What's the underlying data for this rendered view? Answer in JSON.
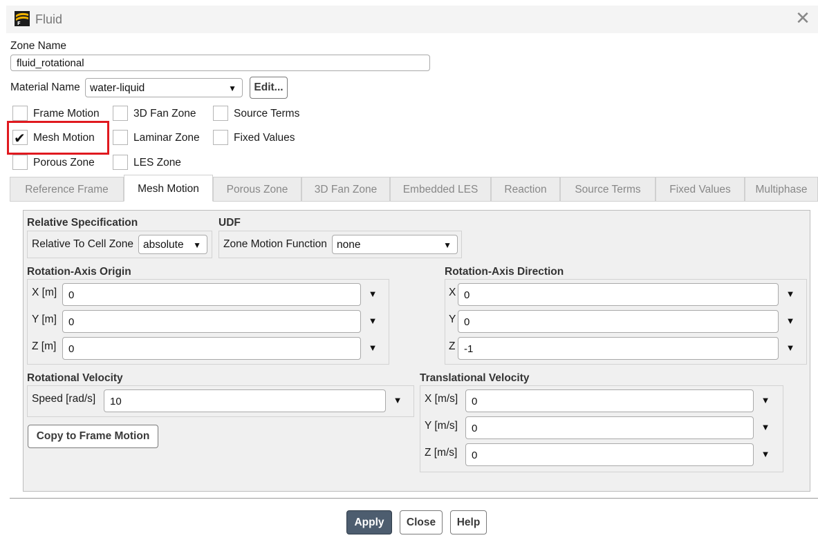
{
  "window": {
    "title": "Fluid",
    "close_glyph": "✕"
  },
  "zone": {
    "label": "Zone Name",
    "value": "fluid_rotational"
  },
  "material": {
    "label": "Material Name",
    "value": "water-liquid",
    "edit_label": "Edit..."
  },
  "options": [
    {
      "label": "Frame Motion",
      "checked": false
    },
    {
      "label": "3D Fan Zone",
      "checked": false
    },
    {
      "label": "Source Terms",
      "checked": false
    },
    {
      "label": "Mesh Motion",
      "checked": true
    },
    {
      "label": "Laminar Zone",
      "checked": false
    },
    {
      "label": "Fixed Values",
      "checked": false
    },
    {
      "label": "Porous Zone",
      "checked": false
    },
    {
      "label": "LES Zone",
      "checked": false
    }
  ],
  "tabs": [
    "Reference Frame",
    "Mesh Motion",
    "Porous Zone",
    "3D Fan Zone",
    "Embedded LES",
    "Reaction",
    "Source Terms",
    "Fixed Values",
    "Multiphase"
  ],
  "active_tab": "Mesh Motion",
  "relative_spec": {
    "title": "Relative Specification",
    "label": "Relative To Cell Zone",
    "value": "absolute"
  },
  "udf": {
    "title": "UDF",
    "label": "Zone Motion Function",
    "value": "none"
  },
  "axis_origin": {
    "title": "Rotation-Axis Origin",
    "fields": [
      {
        "label": "X [m]",
        "value": "0"
      },
      {
        "label": "Y [m]",
        "value": "0"
      },
      {
        "label": "Z [m]",
        "value": "0"
      }
    ]
  },
  "axis_direction": {
    "title": "Rotation-Axis Direction",
    "fields": [
      {
        "label": "X",
        "value": "0"
      },
      {
        "label": "Y",
        "value": "0"
      },
      {
        "label": "Z",
        "value": "-1"
      }
    ]
  },
  "rotational_velocity": {
    "title": "Rotational Velocity",
    "label": "Speed [rad/s]",
    "value": "10",
    "copy_label": "Copy to Frame Motion"
  },
  "translational_velocity": {
    "title": "Translational Velocity",
    "fields": [
      {
        "label": "X [m/s]",
        "value": "0"
      },
      {
        "label": "Y [m/s]",
        "value": "0"
      },
      {
        "label": "Z [m/s]",
        "value": "0"
      }
    ]
  },
  "buttons": {
    "apply": "Apply",
    "close": "Close",
    "help": "Help"
  },
  "glyphs": {
    "dropdown": "▼",
    "check": "✔"
  },
  "colors": {
    "highlight": "#e0191f",
    "primary_button": "#4d5d6f"
  }
}
